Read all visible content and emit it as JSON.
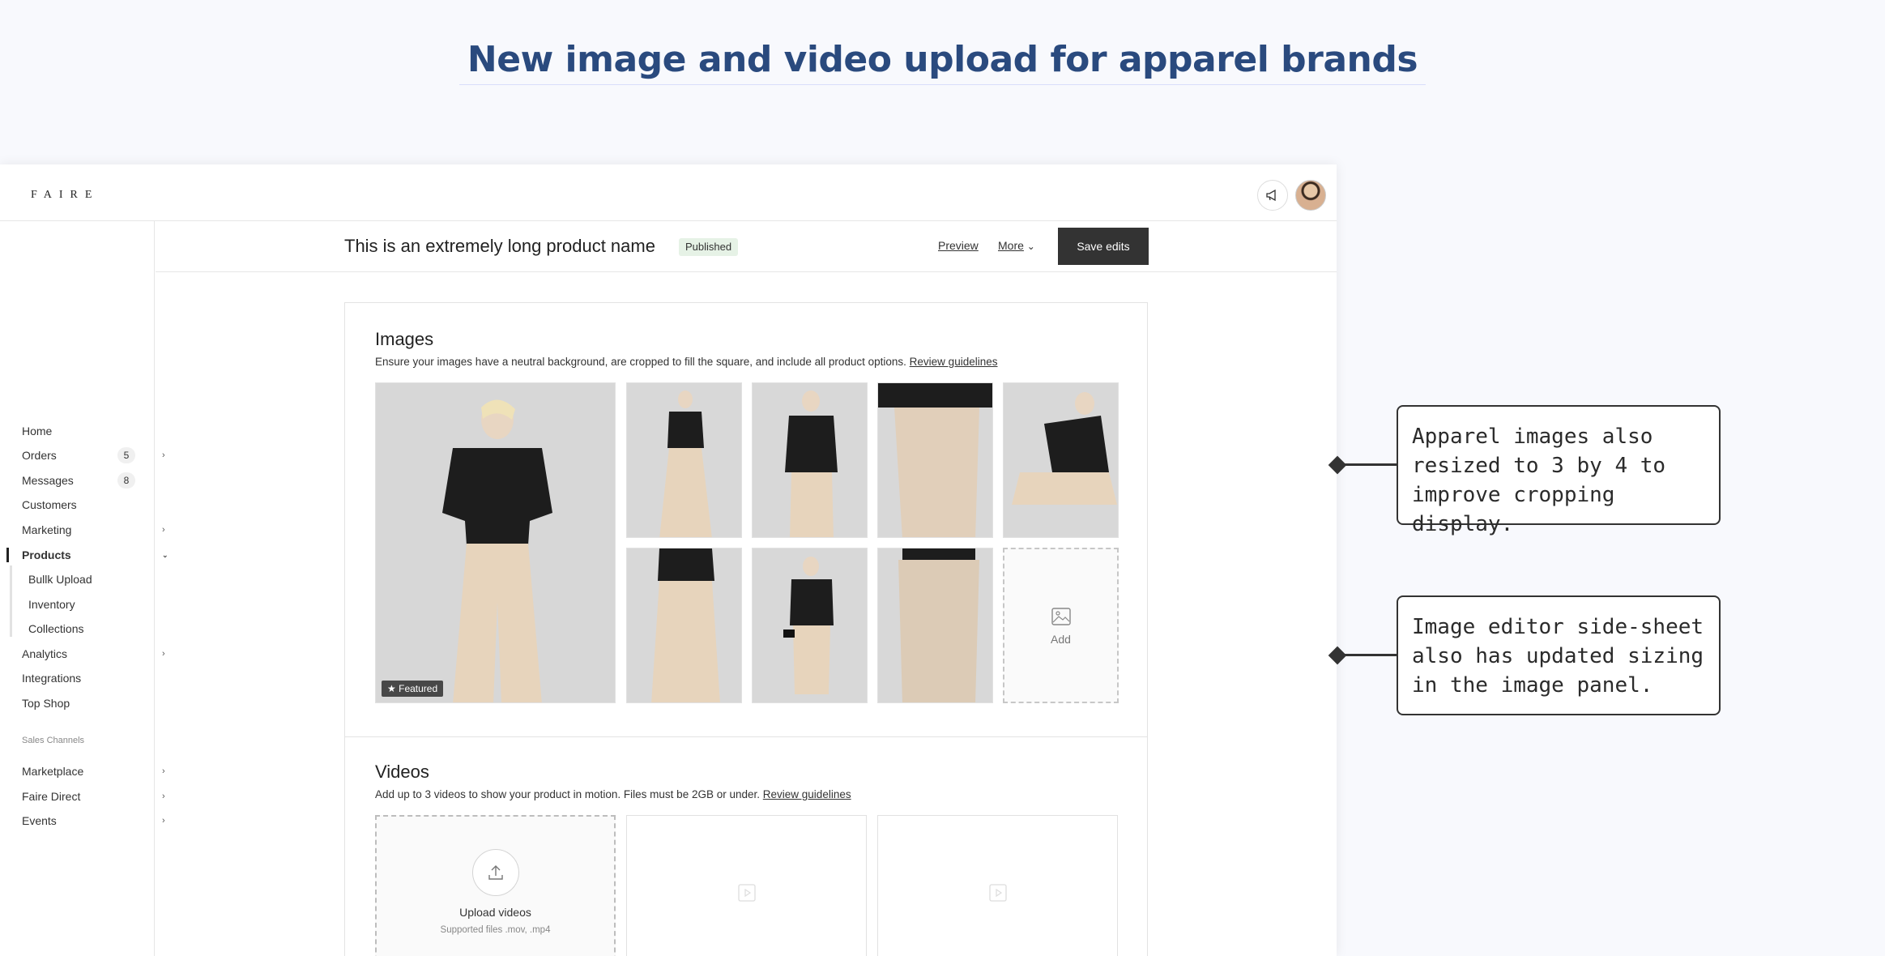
{
  "hero": {
    "title": "New image and video upload for apparel brands"
  },
  "app": {
    "logo": "FAIRE",
    "header": {
      "product_title": "This is an extremely long product name",
      "status": "Published",
      "preview": "Preview",
      "more": "More",
      "save": "Save edits"
    },
    "sidebar": {
      "items": [
        {
          "label": "Home"
        },
        {
          "label": "Orders",
          "badge": "5",
          "chevron": true
        },
        {
          "label": "Messages",
          "badge": "8"
        },
        {
          "label": "Customers"
        },
        {
          "label": "Marketing",
          "chevron": true
        },
        {
          "label": "Products",
          "active": true,
          "expanded": true
        },
        {
          "label": "Bullk Upload",
          "sub": true
        },
        {
          "label": "Inventory",
          "sub": true
        },
        {
          "label": "Collections",
          "sub": true
        },
        {
          "label": "Analytics",
          "chevron": true
        },
        {
          "label": "Integrations"
        },
        {
          "label": "Top Shop"
        }
      ],
      "section_label": "Sales Channels",
      "channels": [
        {
          "label": "Marketplace"
        },
        {
          "label": "Faire Direct"
        },
        {
          "label": "Events"
        }
      ]
    },
    "images": {
      "title": "Images",
      "description": "Ensure your images have a neutral background, are cropped to fill the square, and include all product options.",
      "link": "Review guidelines",
      "featured_label": "Featured",
      "add_label": "Add"
    },
    "videos": {
      "title": "Videos",
      "description": "Add up to 3 videos to show your product in motion. Files must be 2GB or under.",
      "link": "Review guidelines",
      "upload_label": "Upload videos",
      "upload_hint": "Supported files .mov, .mp4"
    }
  },
  "annotations": [
    {
      "text": "Apparel images also resized to 3 by 4 to improve cropping display."
    },
    {
      "text": "Image editor side-sheet also has updated sizing in the image panel."
    }
  ]
}
